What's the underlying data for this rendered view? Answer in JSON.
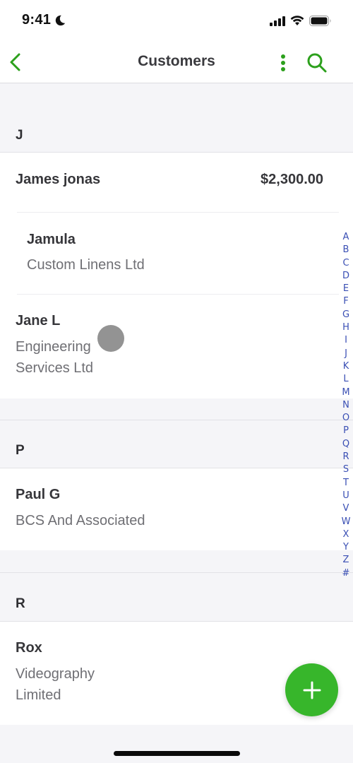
{
  "status_bar": {
    "time": "9:41"
  },
  "nav": {
    "title": "Customers"
  },
  "colors": {
    "accent": "#2ca01c",
    "fab": "#37b62b",
    "index": "#3a4fb4"
  },
  "sections": [
    {
      "letter": "J",
      "rows": [
        {
          "name": "James jonas",
          "amount": "$2,300.00"
        },
        {
          "name": "Jamula",
          "company": "Custom Linens Ltd"
        },
        {
          "name": "Jane L",
          "company_line1": "Engineering",
          "company_line2": "Services Ltd"
        }
      ]
    },
    {
      "letter": "P",
      "rows": [
        {
          "name": "Paul G",
          "company": "BCS And Associated"
        }
      ]
    },
    {
      "letter": "R",
      "rows": [
        {
          "name": "Rox",
          "company_line1": "Videography",
          "company_line2": "Limited"
        }
      ]
    }
  ],
  "index_letters": [
    "A",
    "B",
    "C",
    "D",
    "E",
    "F",
    "G",
    "H",
    "I",
    "J",
    "K",
    "L",
    "M",
    "N",
    "O",
    "P",
    "Q",
    "R",
    "S",
    "T",
    "U",
    "V",
    "W",
    "X",
    "Y",
    "Z",
    "#"
  ],
  "fab": {
    "icon": "plus-icon"
  }
}
